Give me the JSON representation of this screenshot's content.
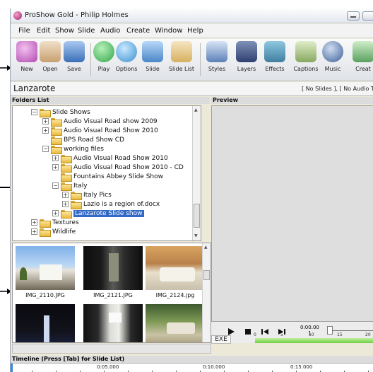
{
  "window": {
    "title": "ProShow Gold - Philip Holmes"
  },
  "menu": [
    "File",
    "Edit",
    "Show",
    "Slide",
    "Audio",
    "Create",
    "Window",
    "Help"
  ],
  "toolbar": [
    {
      "label": "New",
      "icon": "new-show-icon",
      "color": "#b04ab0"
    },
    {
      "label": "Open",
      "icon": "open-icon",
      "color": "#c8a070"
    },
    {
      "label": "Save",
      "icon": "save-icon",
      "color": "#3a6fb8"
    },
    {
      "label": "Play",
      "icon": "play-icon",
      "color": "#2fa54a"
    },
    {
      "label": "Options",
      "icon": "options-icon",
      "color": "#3a8fd0"
    },
    {
      "label": "Slide",
      "icon": "slide-icon",
      "color": "#4a86c8"
    },
    {
      "label": "Slide List",
      "icon": "slide-list-icon",
      "color": "#d8b060"
    },
    {
      "label": "Styles",
      "icon": "styles-icon",
      "color": "#5c80b8"
    },
    {
      "label": "Layers",
      "icon": "layers-icon",
      "color": "#2f3f70"
    },
    {
      "label": "Effects",
      "icon": "effects-icon",
      "color": "#3f7fa0"
    },
    {
      "label": "Captions",
      "icon": "captions-icon",
      "color": "#88a860"
    },
    {
      "label": "Music",
      "icon": "music-icon",
      "color": "#3a5f98"
    },
    {
      "label": "Creat",
      "icon": "create-icon",
      "color": "#5aa060"
    }
  ],
  "show": {
    "name": "Lanzarote",
    "info": "[ No Slides ], [ No Audio T"
  },
  "folders": {
    "header": "Folders List",
    "items": [
      {
        "label": "Slide Shows",
        "level": 0,
        "expander": "−",
        "selected": false
      },
      {
        "label": "Audio Visual Road show 2009",
        "level": 1,
        "expander": "+",
        "selected": false
      },
      {
        "label": "Audio Visual Road Show 2010",
        "level": 1,
        "expander": "+",
        "selected": false
      },
      {
        "label": "BPS Road Show CD",
        "level": 1,
        "expander": "",
        "selected": false
      },
      {
        "label": "working files",
        "level": 1,
        "expander": "−",
        "selected": false
      },
      {
        "label": "Audio Visual Road Show 2010",
        "level": 2,
        "expander": "+",
        "selected": false
      },
      {
        "label": "Audio Visual Road Show 2010 - CD",
        "level": 2,
        "expander": "+",
        "selected": false
      },
      {
        "label": "Fountains Abbey Slide Show",
        "level": 2,
        "expander": "",
        "selected": false
      },
      {
        "label": "Italy",
        "level": 2,
        "expander": "−",
        "selected": false
      },
      {
        "label": "Italy Pics",
        "level": 3,
        "expander": "+",
        "selected": false
      },
      {
        "label": "Lazio is a region of.docx",
        "level": 3,
        "expander": "+",
        "selected": false
      },
      {
        "label": "Lanzarote Slide show",
        "level": 2,
        "expander": "+",
        "selected": true
      },
      {
        "label": "Textures",
        "level": 0,
        "expander": "+",
        "selected": false
      },
      {
        "label": "Wildlife",
        "level": 0,
        "expander": "+",
        "selected": false
      }
    ]
  },
  "preview": {
    "header": "Preview"
  },
  "thumbnails": [
    {
      "name": "IMG_2110.JPG"
    },
    {
      "name": "IMG_2121.JPG"
    },
    {
      "name": "IMG_2124.jpg"
    },
    {
      "name": ""
    },
    {
      "name": ""
    },
    {
      "name": ""
    }
  ],
  "playback": {
    "time": "0:00.00",
    "slide": "1",
    "exe_label": "EXE",
    "ruler": [
      "0",
      "5",
      "10",
      "15",
      "20"
    ]
  },
  "timeline": {
    "header": "Timeline (Press [Tab] for Slide List)",
    "marks": [
      "0:05.000",
      "0:10.000",
      "0:15.000"
    ]
  }
}
